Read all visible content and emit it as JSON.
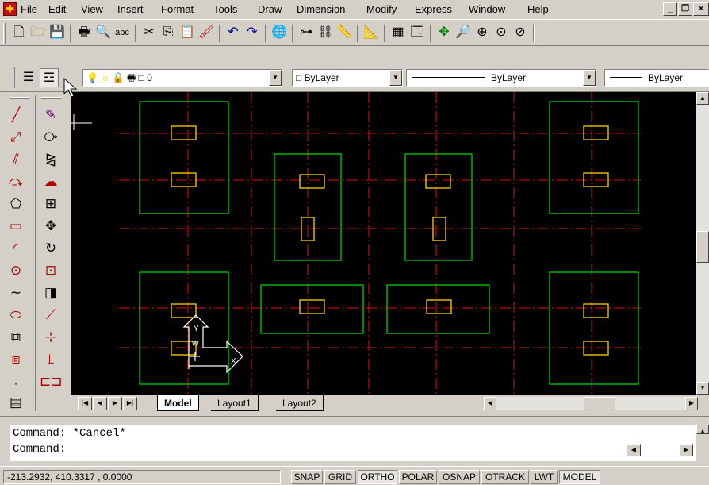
{
  "menu": {
    "items": [
      "File",
      "Edit",
      "View",
      "Insert",
      "Format",
      "Tools",
      "Draw",
      "Dimension",
      "Modify",
      "Express",
      "Window",
      "Help"
    ]
  },
  "window_controls": [
    "_",
    "̱͈",
    "×"
  ],
  "standard_toolbar": {
    "icons": [
      "new-icon",
      "open-icon",
      "save-icon",
      "print-icon",
      "print-preview-icon",
      "spelling-icon",
      "cut-icon",
      "copy-icon",
      "paste-icon",
      "match-properties-icon",
      "undo-icon",
      "redo-icon",
      "internet-icon",
      "tracking-icon",
      "hyperlink-icon",
      "distance-icon",
      "design-center-icon",
      "properties-icon",
      "pan-icon",
      "zoom-realtime-icon",
      "zoom-window-icon",
      "zoom-previous-icon"
    ]
  },
  "layers_toolbar": {
    "layer_value": "0",
    "color_value": "ByLayer",
    "linetype_value": "ByLayer",
    "lineweight_value": "ByLayer"
  },
  "layout_tabs": {
    "nav": [
      "|◀",
      "◀",
      "▶",
      "▶|"
    ],
    "tabs": [
      "Model",
      "Layout1",
      "Layout2"
    ],
    "active": "Model"
  },
  "command_window": {
    "lines": [
      "Command:  *Cancel*",
      "Command:"
    ]
  },
  "status_bar": {
    "coordinates": "-213.2932, 410.3317 , 0.0000",
    "toggles": [
      {
        "label": "SNAP",
        "on": false
      },
      {
        "label": "GRID",
        "on": false
      },
      {
        "label": "ORTHO",
        "on": true
      },
      {
        "label": "POLAR",
        "on": false
      },
      {
        "label": "OSNAP",
        "on": false
      },
      {
        "label": "OTRACK",
        "on": false
      },
      {
        "label": "LWT",
        "on": false
      },
      {
        "label": "MODEL",
        "on": true
      }
    ]
  },
  "ucs_icon": {
    "x_label": "X",
    "y_label": "Y",
    "w_label": "W"
  },
  "colors": {
    "canvas": "#000000",
    "grid_lines": "#e01010",
    "footing_outline": "#00d000",
    "column": "#ffd000",
    "ucs_icon": "#ffffff"
  }
}
